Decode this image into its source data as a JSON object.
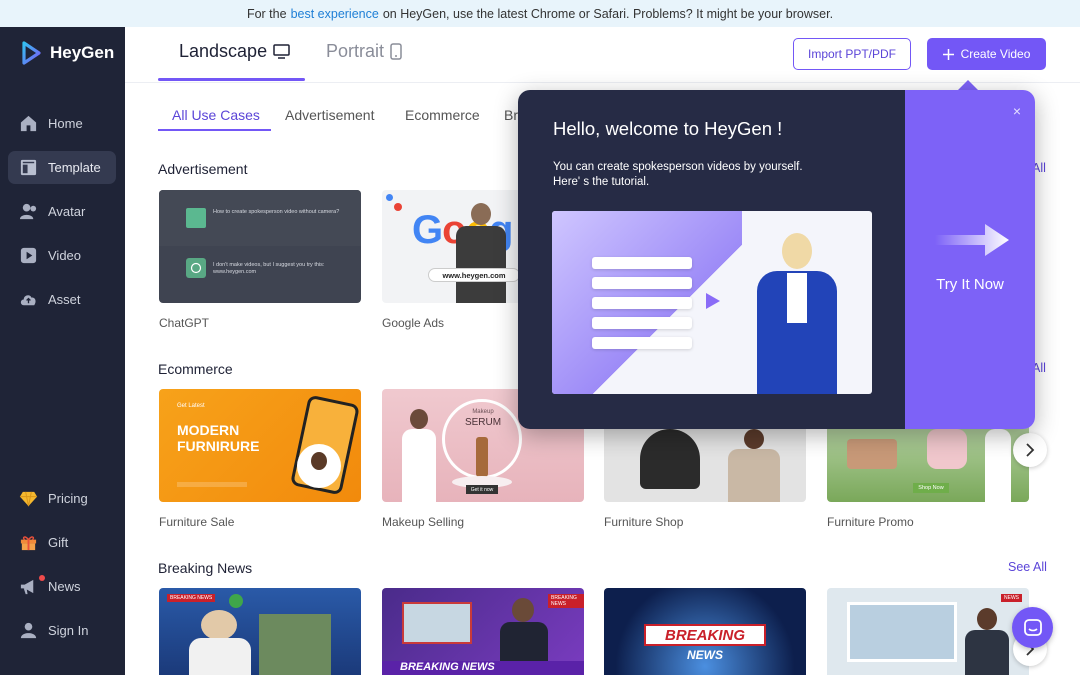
{
  "banner": {
    "prefix": "For the",
    "link": "best experience",
    "suffix": "on HeyGen, use the latest Chrome or Safari. Problems? It might be your browser."
  },
  "app": {
    "name": "HeyGen"
  },
  "sidebar": {
    "items": [
      {
        "label": "Home",
        "icon": "home-icon"
      },
      {
        "label": "Template",
        "icon": "template-icon",
        "active": true
      },
      {
        "label": "Avatar",
        "icon": "avatar-icon"
      },
      {
        "label": "Video",
        "icon": "video-icon"
      },
      {
        "label": "Asset",
        "icon": "cloud-icon"
      }
    ],
    "bottom_items": [
      {
        "label": "Pricing",
        "icon": "diamond-icon"
      },
      {
        "label": "Gift",
        "icon": "gift-icon"
      },
      {
        "label": "News",
        "icon": "megaphone-icon",
        "notification_dot": true
      },
      {
        "label": "Sign In",
        "icon": "sign-in-icon"
      }
    ]
  },
  "orientation_tabs": [
    {
      "label": "Landscape",
      "icon": "monitor-icon",
      "active": true
    },
    {
      "label": "Portrait",
      "icon": "phone-icon",
      "active": false
    }
  ],
  "actions": {
    "import_label": "Import PPT/PDF",
    "create_label": "Create Video"
  },
  "categories": [
    "All Use Cases",
    "Advertisement",
    "Ecommerce",
    "Br"
  ],
  "sections": [
    {
      "title": "Advertisement",
      "see_all": "All",
      "items": [
        {
          "caption": "ChatGPT",
          "chat_q": "How to create spokesperson video without camera?",
          "chat_a": "I don't make videos, but I suggest you try this: www.heygen.com"
        },
        {
          "caption": "Google Ads",
          "brand": "Google",
          "url": "www.heygen.com"
        }
      ]
    },
    {
      "title": "Ecommerce",
      "see_all": "All",
      "items": [
        {
          "caption": "Furniture Sale",
          "small": "Get Latest",
          "headline1": "MODERN",
          "headline2": "FURNIRURE"
        },
        {
          "caption": "Makeup Selling",
          "line1": "Makeup",
          "line2": "SERUM",
          "tag": "Get it now"
        },
        {
          "caption": "Furniture Shop"
        },
        {
          "caption": "Furniture Promo",
          "tag": "Shop Now"
        }
      ]
    },
    {
      "title": "Breaking News",
      "see_all": "See All",
      "items": [
        {
          "badge": "BREAKING NEWS"
        },
        {
          "headline": "BREAKING NEWS",
          "badge": "BREAKING NEWS"
        },
        {
          "line1": "BREAKING",
          "line2": "NEWS"
        },
        {
          "badge": "NEWS"
        }
      ]
    }
  ],
  "popup": {
    "title": "Hello, welcome to HeyGen !",
    "text_line1": "You can create spokesperson videos by yourself.",
    "text_line2": "Here' s the tutorial.",
    "cta": "Try It Now",
    "close": "×"
  },
  "colors": {
    "accent": "#7357f6",
    "sidebar_bg": "#1f2437",
    "popup_bg": "#262b45",
    "popup_cta_bg": "#7d62f7",
    "banner_bg": "#e8f4fb"
  }
}
